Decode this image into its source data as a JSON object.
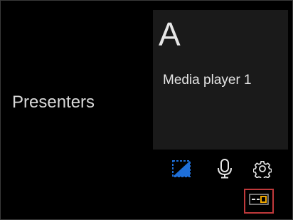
{
  "main": {
    "presenters_label": "Presenters"
  },
  "tile": {
    "letter": "A",
    "name": "Media player 1"
  },
  "toolbar": {
    "items": [
      {
        "name": "video-toggle",
        "icon": "video-preview-icon"
      },
      {
        "name": "microphone",
        "icon": "microphone-icon"
      },
      {
        "name": "settings",
        "icon": "gear-icon"
      }
    ],
    "layout_button": {
      "icon": "layout-toggle-icon",
      "highlighted": true
    }
  },
  "colors": {
    "background": "#000000",
    "tile_background": "#1a1a1a",
    "text": "#e6e6e6",
    "accent_blue": "#1e6fd9",
    "accent_orange": "#f0a800",
    "highlight_border": "#c0393b"
  }
}
